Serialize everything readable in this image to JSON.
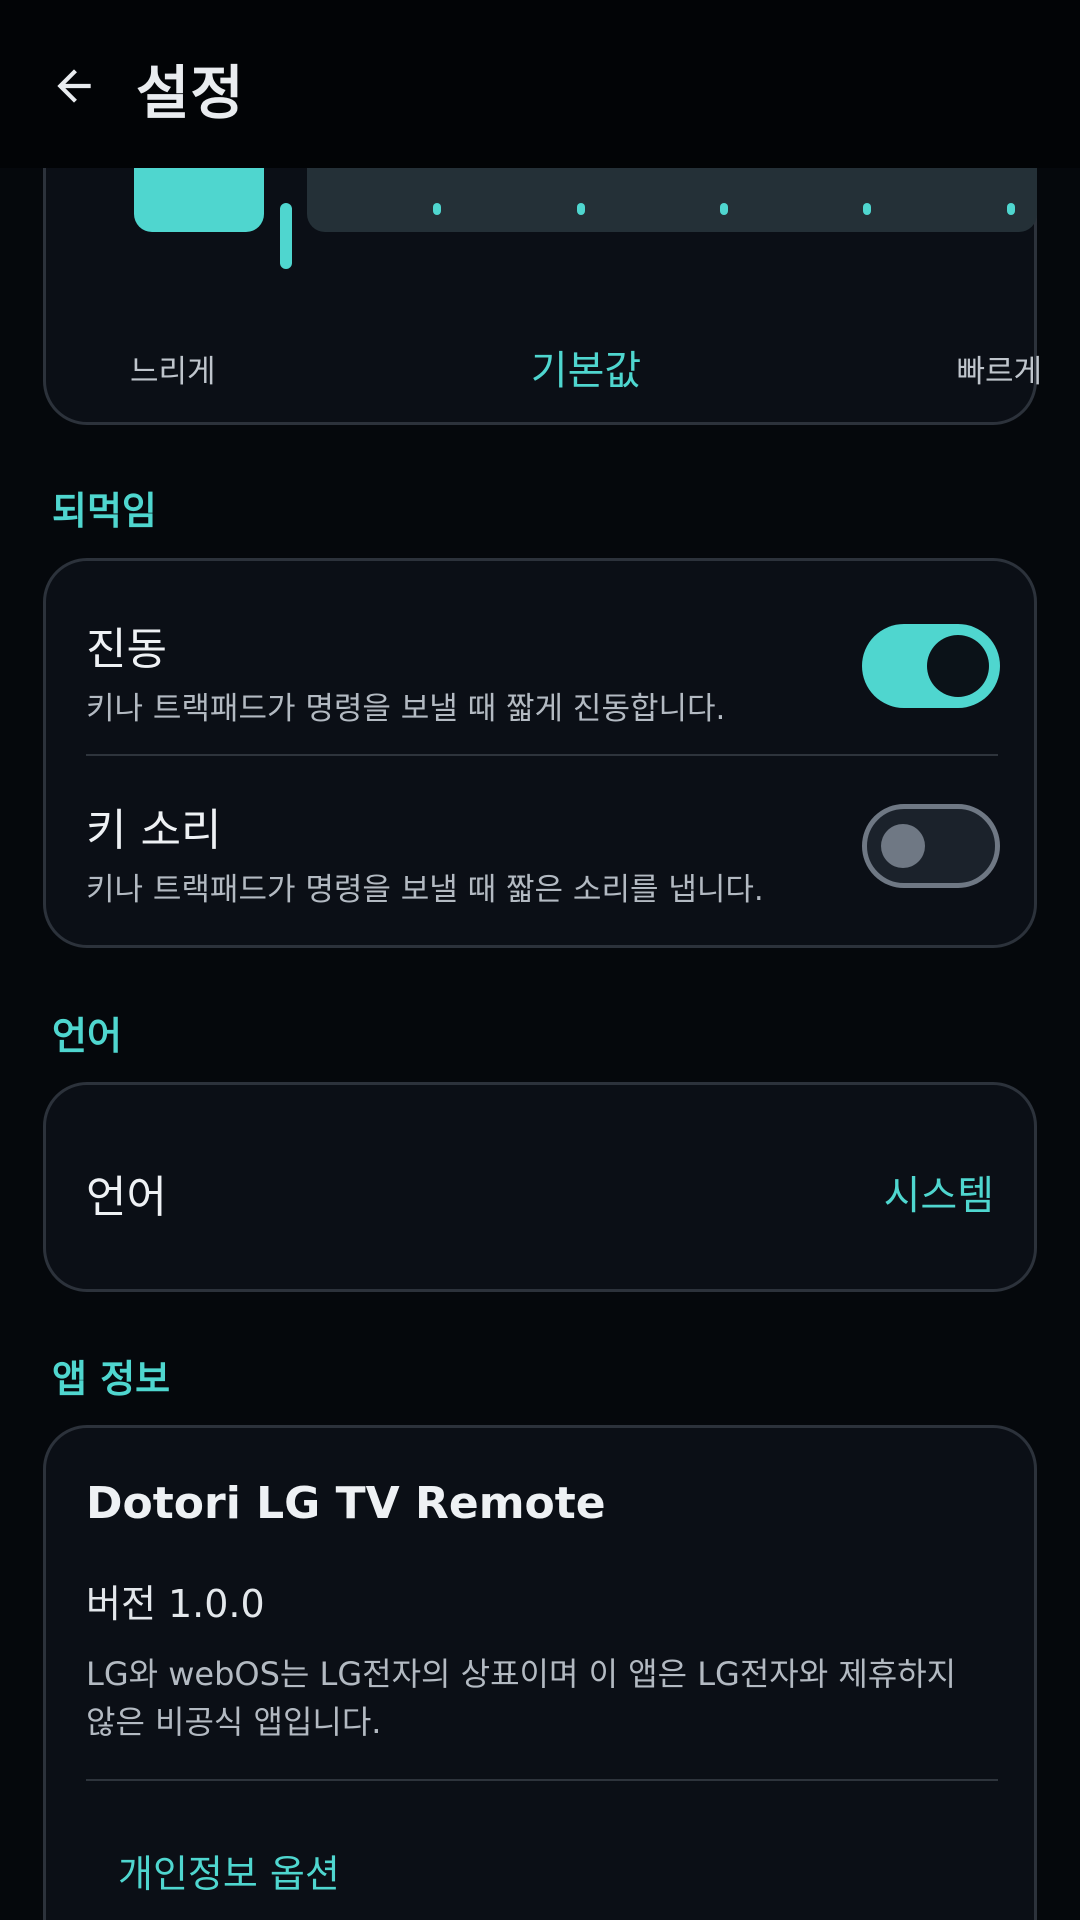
{
  "app_bar": {
    "title": "설정"
  },
  "speed": {
    "slow_label": "느리게",
    "default_label": "기본값",
    "fast_label": "빠르게"
  },
  "feedback": {
    "section_label": "되먹임",
    "vibration": {
      "title": "진동",
      "subtitle": "키나 트랙패드가 명령을 보낼 때 짧게 진동합니다.",
      "enabled": true
    },
    "key_sound": {
      "title": "키 소리",
      "subtitle": "키나 트랙패드가 명령을 보낼 때 짧은 소리를 냅니다.",
      "enabled": false
    }
  },
  "language": {
    "section_label": "언어",
    "label": "언어",
    "value": "시스템"
  },
  "about": {
    "section_label": "앱 정보",
    "app_name": "Dotori LG TV Remote",
    "version": "버전 1.0.0",
    "notice": "LG와 webOS는 LG전자의 상표이며 이 앱은 LG전자와 제휴하지 않은 비공식 앱입니다.",
    "privacy_button": "개인정보 옵션"
  },
  "colors": {
    "accent": "#4fd6cf",
    "background": "#05080c",
    "card": "#0b0f16"
  }
}
